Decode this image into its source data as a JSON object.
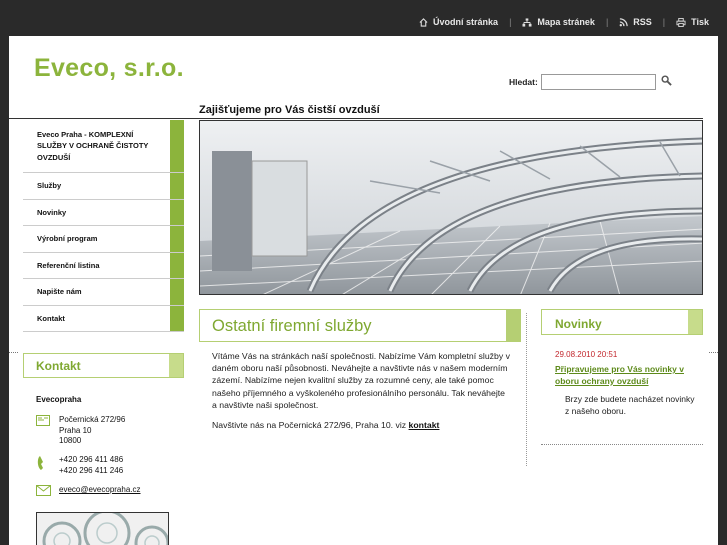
{
  "topnav": {
    "home": "Úvodní stránka",
    "sitemap": "Mapa stránek",
    "rss": "RSS",
    "print": "Tisk"
  },
  "logo": "Eveco, s.r.o.",
  "search": {
    "label": "Hledat:",
    "value": ""
  },
  "headline": "Zajišťujeme pro Vás čistší ovzduší",
  "nav": [
    "Eveco Praha - KOMPLEXNÍ SLUŽBY V OCHRANĚ ČISTOTY OVZDUŠÍ",
    "Služby",
    "Novinky",
    "Výrobní program",
    "Referenční listina",
    "Napište nám",
    "Kontakt"
  ],
  "contact": {
    "title": "Kontakt",
    "company": "Evecopraha",
    "address": [
      "Počernická 272/96",
      "Praha 10",
      "10800"
    ],
    "phones": [
      "+420 296 411 486",
      "+420 296 411 246"
    ],
    "email": "eveco@evecopraha.cz"
  },
  "main": {
    "title": "Ostatní firemní služby",
    "paragraph1": "Vítáme Vás na stránkách naší společnosti. Nabízíme Vám kompletní služby v daném oboru naší působnosti. Neváhejte a navštivte nás v našem moderním zázemí. Nabízíme nejen kvalitní služby za rozumné ceny, ale také pomoc našeho příjemného a vyškoleného profesionálního personálu. Tak neváhejte a navštivte naši společnost.",
    "paragraph2_prefix": "Navštivte nás na Počernická 272/96, Praha 10. viz ",
    "paragraph2_link": "kontakt"
  },
  "news": {
    "title": "Novinky",
    "date": "29.08.2010 20:51",
    "link": "Připravujeme pro Vás novinky v oboru ochrany ovzduší",
    "text": "Brzy zde budete nacházet novinky z našeho oboru."
  },
  "colors": {
    "accent": "#8cb43c",
    "topbar": "#2a2a2a",
    "date": "#c2272d"
  }
}
